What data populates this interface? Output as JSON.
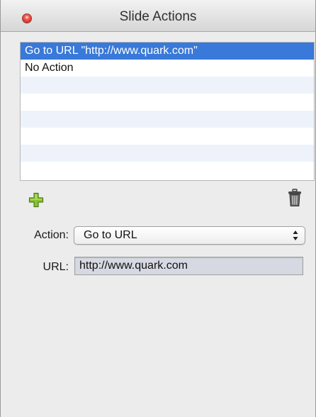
{
  "window": {
    "title": "Slide Actions"
  },
  "action_list": {
    "items": [
      {
        "label": "Go to URL \"http://www.quark.com\"",
        "selected": true
      },
      {
        "label": "No Action",
        "selected": false
      },
      {
        "label": "",
        "selected": false
      },
      {
        "label": "",
        "selected": false
      },
      {
        "label": "",
        "selected": false
      },
      {
        "label": "",
        "selected": false
      },
      {
        "label": "",
        "selected": false
      },
      {
        "label": "",
        "selected": false
      }
    ]
  },
  "toolbar": {
    "add_icon": "plus-icon",
    "delete_icon": "trash-icon"
  },
  "form": {
    "action_label": "Action:",
    "action_value": "Go to URL",
    "url_label": "URL:",
    "url_value": "http://www.quark.com"
  },
  "colors": {
    "selection": "#3879d9",
    "stripe": "#eef3fb",
    "add_icon": "#86c232",
    "url_field_bg": "#d6d9e2"
  }
}
